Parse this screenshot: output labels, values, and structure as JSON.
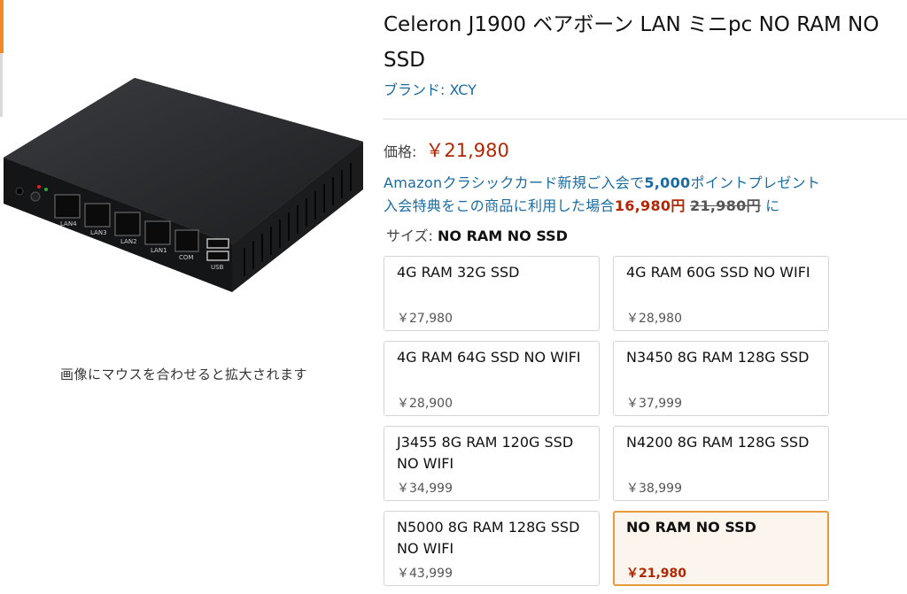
{
  "product": {
    "title": "Celeron J1900 ベアボーン LAN ミニpc NO RAM NO SSD",
    "brand": "ブランド: XCY",
    "image_hint": "画像にマウスを合わせると拡大されます",
    "port_labels": [
      "LAN4",
      "LAN3",
      "LAN2",
      "LAN1",
      "COM",
      "USB"
    ]
  },
  "price": {
    "label": "価格:",
    "value": "￥21,980"
  },
  "promo": {
    "line1_prefix": "Amazonクラシックカード新規ご入会で",
    "line1_points": "5,000",
    "line1_suffix": "ポイントプレゼント",
    "line2_prefix": "入会特典をこの商品に利用した場合",
    "line2_discounted": "16,980円",
    "line2_original": "21,980円",
    "line2_suffix": "に"
  },
  "size": {
    "label": "サイズ:",
    "selected": "NO RAM NO SSD"
  },
  "options": [
    {
      "name": "4G RAM 32G SSD",
      "price": "￥27,980"
    },
    {
      "name": "4G RAM 60G SSD NO WIFI",
      "price": "￥28,980"
    },
    {
      "name": "4G RAM 64G SSD NO WIFI",
      "price": "￥28,900"
    },
    {
      "name": "N3450 8G RAM 128G SSD",
      "price": "￥37,999"
    },
    {
      "name": "J3455 8G RAM 120G SSD NO WIFI",
      "price": "￥34,999"
    },
    {
      "name": "N4200 8G RAM 128G SSD",
      "price": "￥38,999"
    },
    {
      "name": "N5000 8G RAM 128G SSD NO WIFI",
      "price": "￥43,999"
    },
    {
      "name": "NO RAM NO SSD",
      "price": "￥21,980"
    }
  ],
  "colors": {
    "price_red": "#b12704",
    "link_blue": "#1a6ba0",
    "selected_border": "#e89a3c",
    "selected_bg": "#fcf5ee"
  }
}
